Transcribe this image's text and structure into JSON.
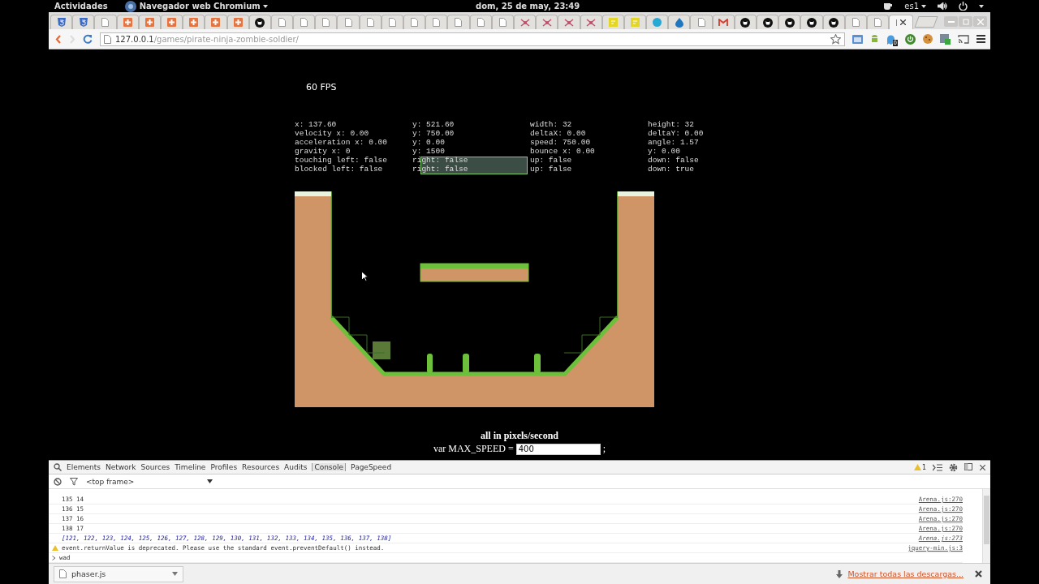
{
  "top_bar": {
    "activities": "Actividades",
    "app_menu": "Navegador web Chromium",
    "clock": "dom, 25 de may, 23:49",
    "keyboard": "es1"
  },
  "tabs": [
    {
      "kind": "html5",
      "selected": false
    },
    {
      "kind": "html5",
      "selected": false
    },
    {
      "kind": "page",
      "selected": false
    },
    {
      "kind": "plus",
      "selected": false
    },
    {
      "kind": "plus",
      "selected": false
    },
    {
      "kind": "plus",
      "selected": false
    },
    {
      "kind": "plus",
      "selected": false
    },
    {
      "kind": "plus",
      "selected": false
    },
    {
      "kind": "plus",
      "selected": false
    },
    {
      "kind": "github",
      "selected": false
    },
    {
      "kind": "page",
      "selected": false
    },
    {
      "kind": "page",
      "selected": false
    },
    {
      "kind": "page",
      "selected": false
    },
    {
      "kind": "page",
      "selected": false
    },
    {
      "kind": "page",
      "selected": false
    },
    {
      "kind": "page",
      "selected": false
    },
    {
      "kind": "page",
      "selected": false
    },
    {
      "kind": "page",
      "selected": false
    },
    {
      "kind": "page",
      "selected": false
    },
    {
      "kind": "page",
      "selected": false
    },
    {
      "kind": "page",
      "selected": false
    },
    {
      "kind": "bug",
      "selected": false
    },
    {
      "kind": "bug",
      "selected": false
    },
    {
      "kind": "bug",
      "selected": false
    },
    {
      "kind": "bug",
      "selected": false
    },
    {
      "kind": "note",
      "selected": false
    },
    {
      "kind": "note",
      "selected": false
    },
    {
      "kind": "circle",
      "selected": false
    },
    {
      "kind": "drop",
      "selected": false
    },
    {
      "kind": "page",
      "selected": false
    },
    {
      "kind": "mail",
      "selected": false
    },
    {
      "kind": "github",
      "selected": false
    },
    {
      "kind": "github",
      "selected": false
    },
    {
      "kind": "github",
      "selected": false
    },
    {
      "kind": "github",
      "selected": false
    },
    {
      "kind": "github",
      "selected": false
    },
    {
      "kind": "page",
      "selected": false
    },
    {
      "kind": "page",
      "selected": false
    },
    {
      "kind": "blank",
      "selected": true
    }
  ],
  "toolbar": {
    "url_host": "127.0.0.1",
    "url_path": "/games/pirate-ninja-zombie-soldier/",
    "extension_badge": "0"
  },
  "page": {
    "fps": "60 FPS",
    "debug_columns": [
      [
        "x: 137.60",
        "velocity x: 0.00",
        "acceleration x: 0.00",
        "gravity x: 0",
        "touching left: false",
        "blocked left: false"
      ],
      [
        "y: 521.60",
        "y: 750.00",
        "y: 0.00",
        "y: 1500",
        "right: false",
        "right: false"
      ],
      [
        "width: 32",
        "deltaX: 0.00",
        "speed: 750.00",
        "bounce x: 0.00",
        "up: false",
        "up: false"
      ],
      [
        "height: 32",
        "deltaY: 0.00",
        "angle: 1.57",
        "y: 0.00",
        "down: false",
        "down: true"
      ]
    ],
    "speed_note": "all in pixels/second",
    "max_speed": {
      "label": "var MAX_SPEED =",
      "value": "400",
      "suffix": ";"
    }
  },
  "devtools": {
    "tabs": [
      {
        "label": "Elements",
        "selected": false
      },
      {
        "label": "Network",
        "selected": false
      },
      {
        "label": "Sources",
        "selected": false
      },
      {
        "label": "Timeline",
        "selected": false
      },
      {
        "label": "Profiles",
        "selected": false
      },
      {
        "label": "Resources",
        "selected": false
      },
      {
        "label": "Audits",
        "selected": false
      },
      {
        "label": "Console",
        "selected": true
      },
      {
        "label": "PageSpeed",
        "selected": false
      }
    ],
    "warning_count": "1",
    "frame": "<top frame>",
    "console": [
      {
        "kind": "log",
        "text": "135 14",
        "source": "Arena.js:270"
      },
      {
        "kind": "log",
        "text": "136 15",
        "source": "Arena.js:270"
      },
      {
        "kind": "log",
        "text": "137 16",
        "source": "Arena.js:270"
      },
      {
        "kind": "log",
        "text": "138 17",
        "source": "Arena.js:270"
      },
      {
        "kind": "array",
        "text": "[121, 122, 123, 124, 125, 126, 127, 128, 129, 130, 131, 132, 133, 134, 135, 136, 137, 138]",
        "source": "Arena.js:273"
      },
      {
        "kind": "warning",
        "text": "event.returnValue is deprecated. Please use the standard event.preventDefault() instead.",
        "source": "jquery-min.js:3"
      },
      {
        "kind": "input",
        "text": "wad"
      }
    ]
  },
  "downloads": {
    "file": "phaser.js",
    "show_all": "Mostrar todas las descargas..."
  }
}
